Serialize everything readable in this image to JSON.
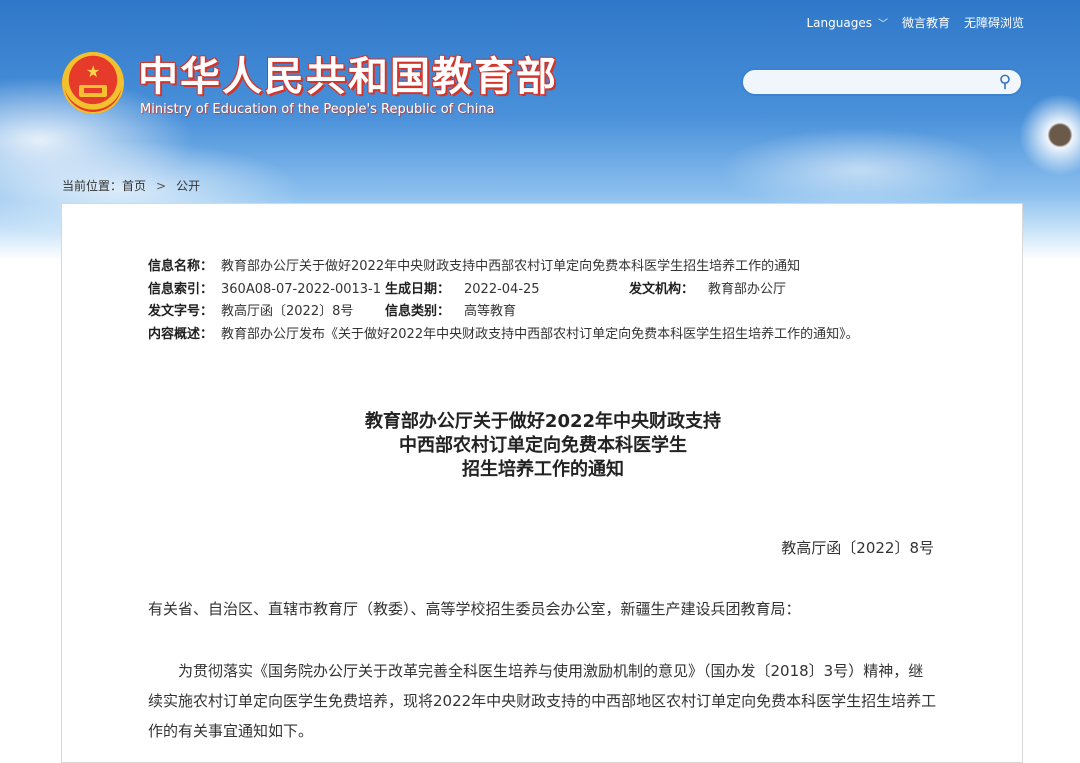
{
  "header": {
    "languages_label": "Languages",
    "weibo_label": "微言教育",
    "accessibility_label": "无障碍浏览",
    "site_title": "中华人民共和国教育部",
    "site_subtitle": "Ministry of Education of the People's Republic of China",
    "search_placeholder": ""
  },
  "breadcrumb": {
    "prefix": "当前位置：",
    "home": "首页",
    "separator": ">",
    "current": "公开"
  },
  "meta": {
    "name_label": "信息名称：",
    "name_value": "教育部办公厅关于做好2022年中央财政支持中西部农村订单定向免费本科医学生招生培养工作的通知",
    "index_label": "信息索引：",
    "index_value": "360A08-07-2022-0013-1",
    "date_label": "生成日期：",
    "date_value": "2022-04-25",
    "issuer_label": "发文机构：",
    "issuer_value": "教育部办公厅",
    "docno_label": "发文字号：",
    "docno_value": "教高厅函〔2022〕8号",
    "category_label": "信息类别：",
    "category_value": "高等教育",
    "summary_label": "内容概述：",
    "summary_value": "教育部办公厅发布《关于做好2022年中央财政支持中西部农村订单定向免费本科医学生招生培养工作的通知》。"
  },
  "document": {
    "title_line1": "教育部办公厅关于做好2022年中央财政支持",
    "title_line2": "中西部农村订单定向免费本科医学生",
    "title_line3": "招生培养工作的通知",
    "number": "教高厅函〔2022〕8号",
    "address": "有关省、自治区、直辖市教育厅（教委）、高等学校招生委员会办公室，新疆生产建设兵团教育局：",
    "body": "为贯彻落实《国务院办公厅关于改革完善全科医生培养与使用激励机制的意见》（国办发〔2018〕3号）精神，继续实施农村订单定向医学生免费培养，现将2022年中央财政支持的中西部地区农村订单定向免费本科医学生招生培养工作的有关事宜通知如下。"
  }
}
